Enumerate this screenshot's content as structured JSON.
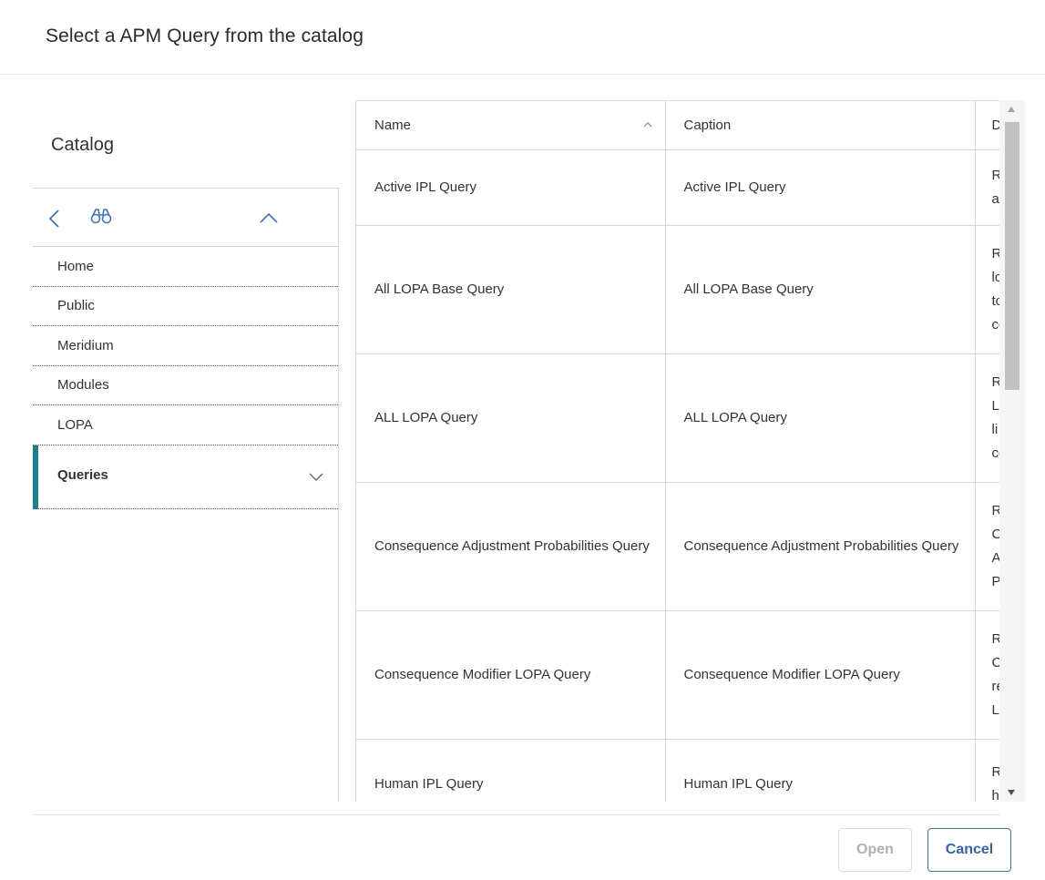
{
  "dialog": {
    "title": "Select a APM Query from the catalog"
  },
  "catalog": {
    "title": "Catalog",
    "toolbar": {
      "back_icon": "chevron-left-icon",
      "search_icon": "binoculars-icon",
      "collapse_icon": "chevron-up-icon"
    },
    "items": [
      {
        "label": "Home"
      },
      {
        "label": "Public"
      },
      {
        "label": "Meridium"
      },
      {
        "label": "Modules"
      },
      {
        "label": "LOPA"
      },
      {
        "label": "Queries",
        "active": true
      }
    ]
  },
  "grid": {
    "columns": [
      {
        "label": "Name",
        "sorted": "ascending"
      },
      {
        "label": "Caption"
      },
      {
        "label": "D"
      }
    ],
    "rows": [
      {
        "name": "Active IPL Query",
        "caption": "Active IPL Query",
        "desc": "R\na"
      },
      {
        "name": "All LOPA Base Query",
        "caption": "All LOPA Base Query",
        "desc": "R\nlc\ntc\ncc"
      },
      {
        "name": "ALL LOPA Query",
        "caption": "ALL LOPA Query",
        "desc": "R\nL\nli\ncc"
      },
      {
        "name": "Consequence Adjustment Probabilities Query",
        "caption": "Consequence Adjustment Probabilities Query",
        "desc": "R\nC\nA\nP"
      },
      {
        "name": "Consequence Modifier LOPA Query",
        "caption": "Consequence Modifier LOPA Query",
        "desc": "R\nC\nre\nL"
      },
      {
        "name": "Human IPL Query",
        "caption": "Human IPL Query",
        "desc": "R\nh"
      }
    ]
  },
  "footer": {
    "open_label": "Open",
    "cancel_label": "Cancel",
    "open_disabled": true
  },
  "colors": {
    "accent": "#1b7f8f",
    "primary_button": "#2f64b5"
  }
}
